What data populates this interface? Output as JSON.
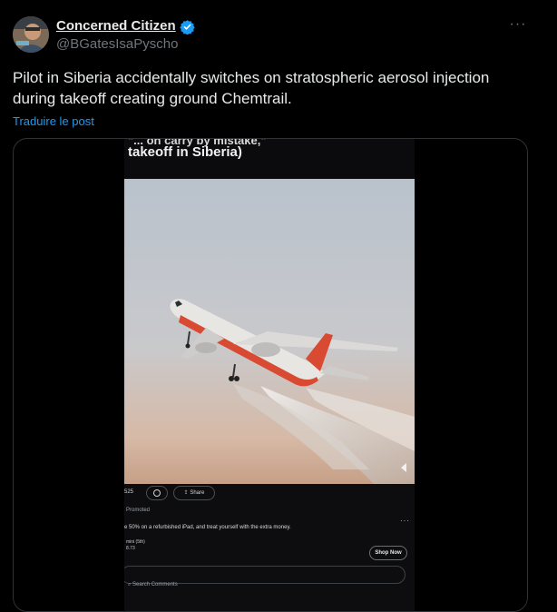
{
  "author": {
    "display_name": "Concerned Citizen",
    "handle": "@BGatesIsaPyscho",
    "verified": true,
    "avatar_icon": "avatar-photo-icon"
  },
  "tweet": {
    "text": "Pilot in Siberia accidentally switches on stratospheric aerosol injection during takeoff creating ground Chemtrail.",
    "translate_label": "Traduire le post",
    "more_label": "···"
  },
  "media": {
    "caption_top": "\"... on carry by mistake,\"",
    "caption_main": "takeoff in Siberia)",
    "reaction_count": "525",
    "share_label": "Share",
    "promoted_label": "Promoted",
    "ad_text": "e 50% on a refurbished iPad, and treat yourself with the extra money.",
    "ad_meta_1": "mini (5th)",
    "ad_meta_2": "8.73",
    "shop_button": "Shop Now",
    "comment_placeholder": "Search Comments",
    "dots": "···"
  },
  "colors": {
    "background": "#000000",
    "text": "#e7e9ea",
    "muted": "#71767b",
    "link": "#1d9bf0",
    "verified_badge": "#1d9bf0",
    "border": "#2f3336"
  }
}
